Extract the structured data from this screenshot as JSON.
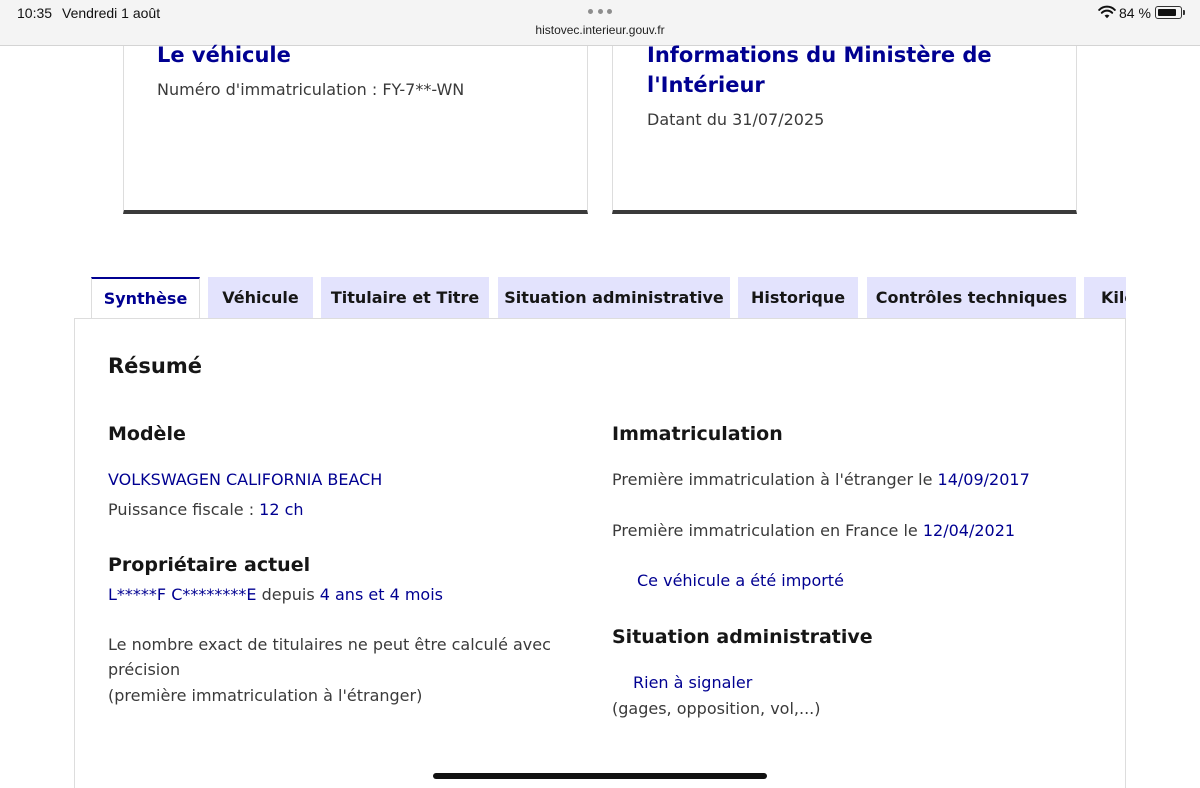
{
  "status_bar": {
    "time": "10:35",
    "date": "Vendredi 1 août",
    "url": "histovec.interieur.gouv.fr",
    "battery": "84 %",
    "battery_level": 0.84,
    "icons": [
      "more-dots-icon",
      "wifi-icon",
      "battery-icon"
    ]
  },
  "cards": {
    "vehicule": {
      "title": "Le véhicule",
      "subtitle": "Numéro d'immatriculation : FY-7**-WN"
    },
    "ministere": {
      "title": "Informations du Ministère de l'Intérieur",
      "subtitle": "Datant du 31/07/2025"
    }
  },
  "tabs": [
    {
      "label": "Synthèse",
      "active": true
    },
    {
      "label": "Véhicule",
      "active": false
    },
    {
      "label": "Titulaire et Titre",
      "active": false
    },
    {
      "label": "Situation administrative",
      "active": false
    },
    {
      "label": "Historique",
      "active": false
    },
    {
      "label": "Contrôles techniques",
      "active": false
    },
    {
      "label": "Kilométrage",
      "active": false
    }
  ],
  "summary": {
    "heading": "Résumé",
    "modele": {
      "heading": "Modèle",
      "name": "VOLKSWAGEN CALIFORNIA BEACH",
      "puissance_label": "Puissance fiscale : ",
      "puissance_value": "12 ch"
    },
    "proprietaire": {
      "heading": "Propriétaire actuel",
      "name": "L*****F C********E",
      "depuis_label": " depuis ",
      "duree": "4 ans et 4 mois",
      "note_line1": "Le nombre exact de titulaires ne peut être calculé avec",
      "note_line2": "précision",
      "note_line3": "(première immatriculation à l'étranger)"
    },
    "immatriculation": {
      "heading": "Immatriculation",
      "etranger_label": "Première immatriculation à l'étranger le ",
      "etranger_date": "14/09/2017",
      "france_label": "Première immatriculation en France le ",
      "france_date": "12/04/2021",
      "importe": "Ce véhicule a été importé"
    },
    "situation": {
      "heading": "Situation administrative",
      "status": "Rien à signaler",
      "detail": "(gages, opposition, vol,...)"
    }
  },
  "colors": {
    "accent": "#000091",
    "tab_bg": "#e3e3fd",
    "text": "#3a3a3a",
    "heading": "#161616"
  }
}
